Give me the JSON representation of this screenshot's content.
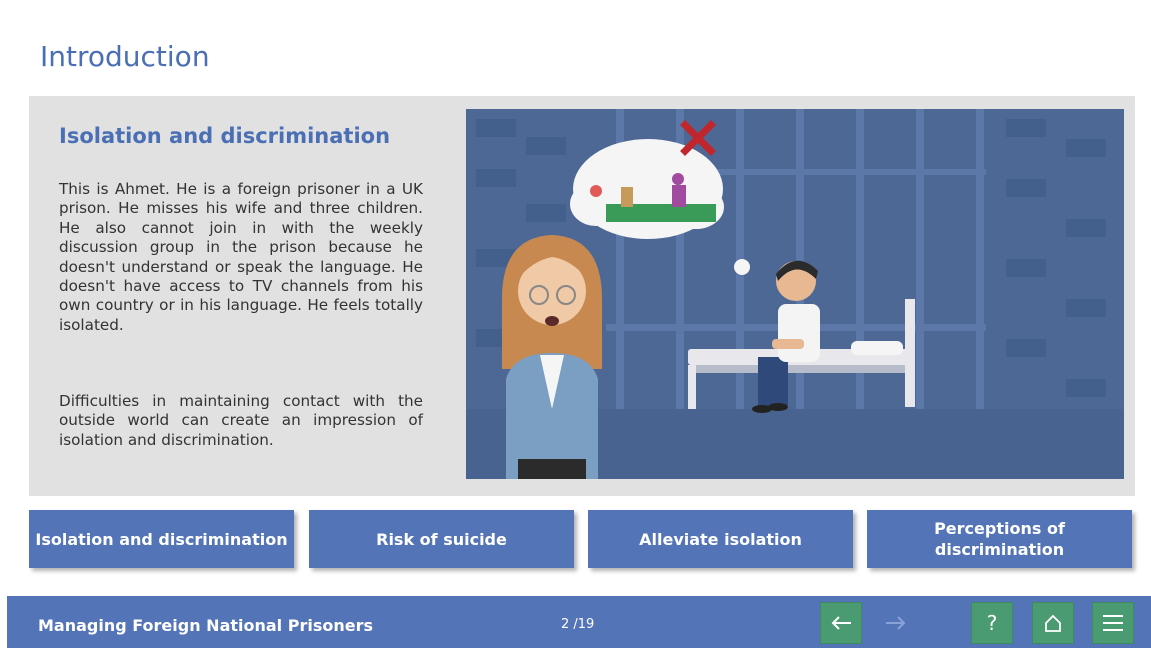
{
  "header": {
    "title": "Introduction"
  },
  "content": {
    "heading": "Isolation and discrimination",
    "paragraph1": "This is Ahmet. He is a foreign prisoner in a UK prison. He misses his wife and three children. He also cannot join in with the weekly discussion group in the prison because he doesn't understand or speak the language. He doesn't have access to TV channels from his own country or in his language. He feels totally isolated.",
    "paragraph2": "Difficulties in maintaining contact with the outside world can create an impression of isolation and discrimination."
  },
  "tabs": [
    {
      "label": "Isolation and discrimination"
    },
    {
      "label": "Risk of suicide"
    },
    {
      "label": "Alleviate isolation"
    },
    {
      "label": "Perceptions of discrimination"
    }
  ],
  "footer": {
    "course_title": "Managing Foreign National Prisoners",
    "page_indicator": "2 /19",
    "controls": [
      {
        "icon": "arrow-left-icon",
        "state": "enabled"
      },
      {
        "icon": "arrow-right-icon",
        "state": "disabled"
      },
      {
        "icon": "help-icon",
        "label": "?",
        "state": "enabled"
      },
      {
        "icon": "home-icon",
        "state": "enabled"
      },
      {
        "icon": "menu-icon",
        "state": "enabled"
      }
    ]
  },
  "colors": {
    "accent": "#5474b8",
    "title": "#4a6fb5",
    "panel_bg": "#e1e1e1",
    "control_green": "#4a9a72"
  }
}
